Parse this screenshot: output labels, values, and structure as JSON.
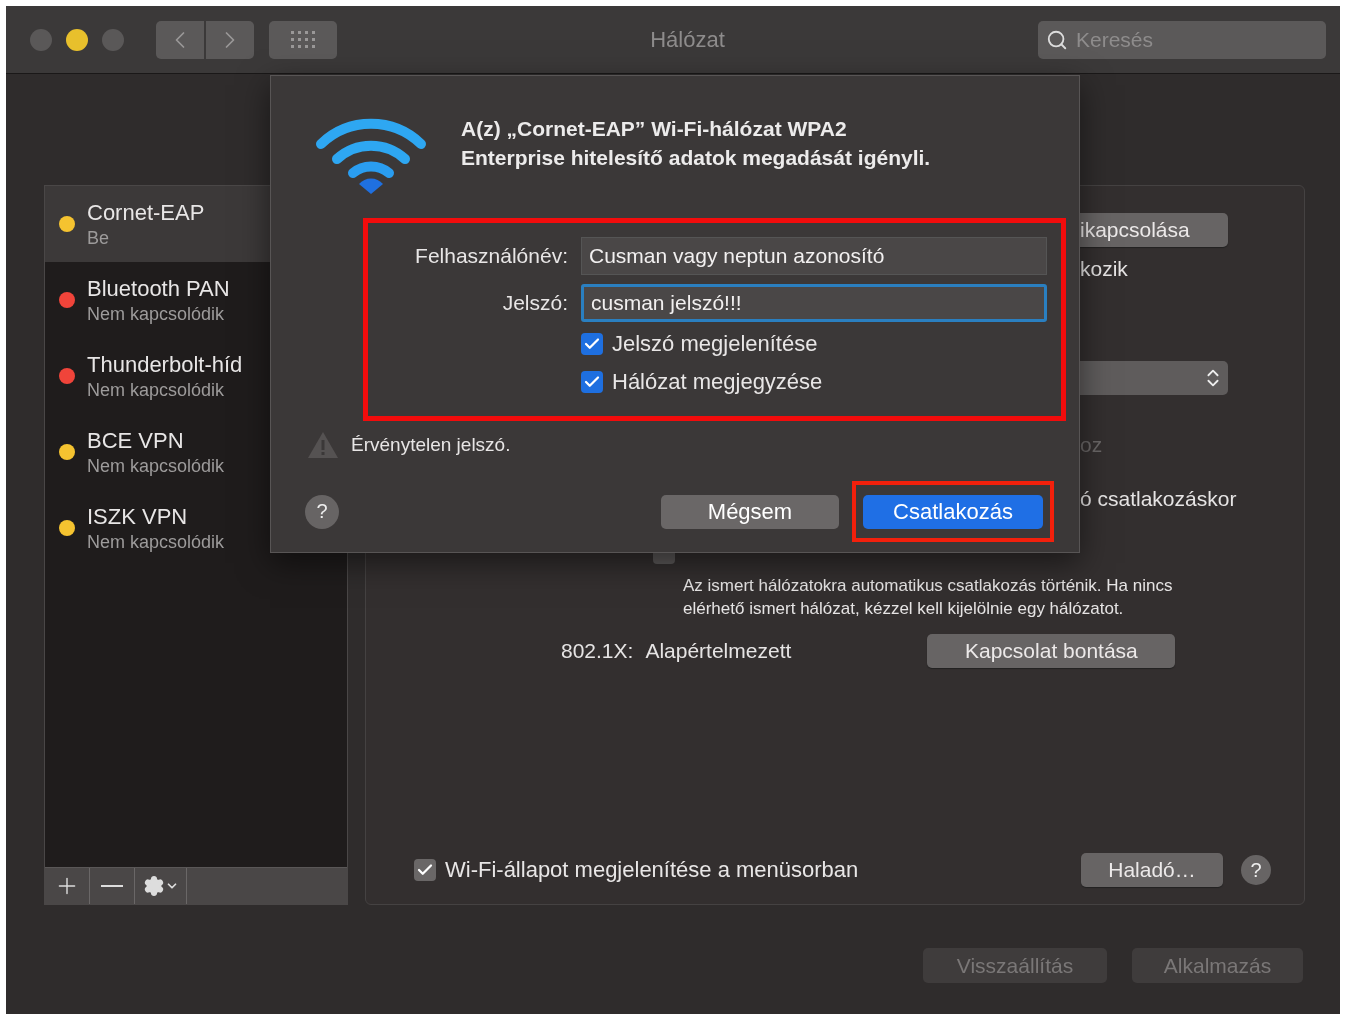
{
  "window": {
    "title": "Hálózat",
    "search": {
      "placeholder": "Keresés"
    }
  },
  "sidebar": {
    "items": [
      {
        "name": "Cornet-EAP",
        "status": "Be",
        "color": "#f5c330",
        "selected": true
      },
      {
        "name": "Bluetooth PAN",
        "status": "Nem kapcsolódik",
        "color": "#f0443a",
        "selected": false
      },
      {
        "name": "Thunderbolt-híd",
        "status": "Nem kapcsolódik",
        "color": "#f0443a",
        "selected": false
      },
      {
        "name": "BCE VPN",
        "status": "Nem kapcsolódik",
        "color": "#f5c330",
        "selected": false
      },
      {
        "name": "ISZK VPN",
        "status": "Nem kapcsolódik",
        "color": "#f5c330",
        "selected": false
      }
    ]
  },
  "panel": {
    "wifi_button": "ikapcsolása",
    "status_fragment": "kozik",
    "dimmed_fragment": "oz",
    "option_fragment": "ó csatlakozáskor",
    "ask_checkbox": {
      "checked": false
    },
    "description": "Az ismert hálózatokra automatikus csatlakozás történik. Ha nincs elérhető ismert hálózat, kézzel kell kijelölnie egy hálózatot.",
    "dot1x": {
      "label": "802.1X:",
      "value": "Alapértelmezett"
    },
    "disconnect_button": "Kapcsolat bontása",
    "menu_checkbox": {
      "label": "Wi-Fi-állapot megjelenítése a menüsorban",
      "checked": true
    },
    "advanced_button": "Haladó…",
    "help": "?"
  },
  "footer_buttons": [
    {
      "label": "Visszaállítás",
      "disabled": true
    },
    {
      "label": "Alkalmazás",
      "disabled": true
    }
  ],
  "dialog": {
    "title": "A(z) „Cornet-EAP” Wi-Fi-hálózat WPA2\nEnterprise hitelesítő adatok megadását igényli.",
    "fields": [
      {
        "label": "Felhasználónév:",
        "value": "Cusman vagy neptun azonosító",
        "focused": false
      },
      {
        "label": "Jelszó:",
        "value": "cusman jelszó!!!",
        "focused": true
      }
    ],
    "checkboxes": [
      {
        "label": "Jelszó megjelenítése",
        "checked": true
      },
      {
        "label": "Hálózat megjegyzése",
        "checked": true
      }
    ],
    "error": "Érvénytelen jelszó.",
    "help": "?",
    "buttons": [
      {
        "label": "Mégsem",
        "default": false
      },
      {
        "label": "Csatlakozás",
        "default": true
      }
    ]
  }
}
